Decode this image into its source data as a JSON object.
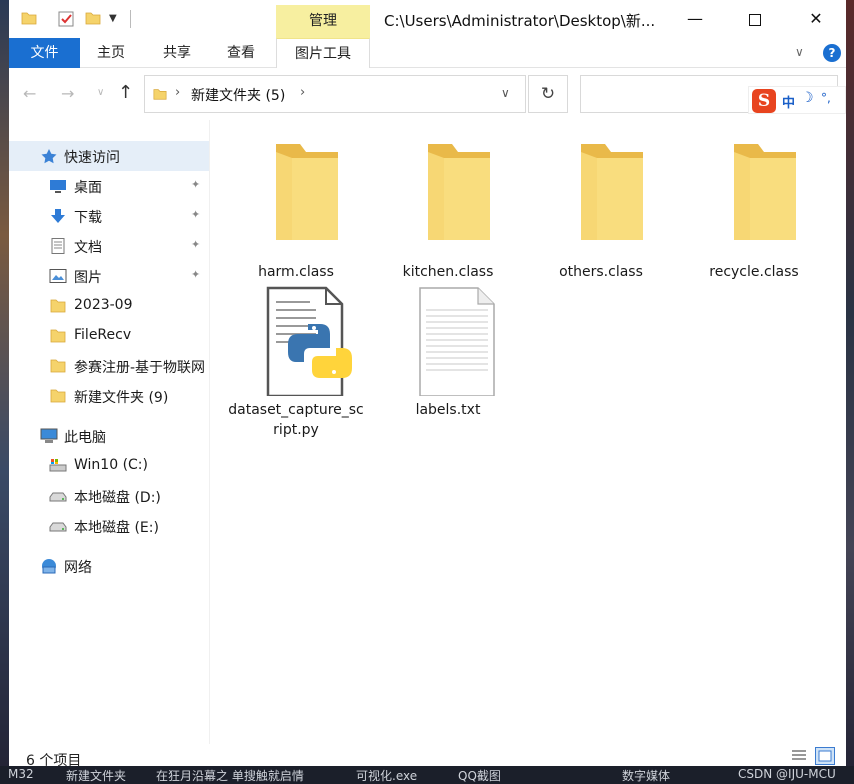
{
  "window": {
    "title_path": "C:\\Users\\Administrator\\Desktop\\新...",
    "manage_tab": "管理",
    "controls": {
      "minimize": "—",
      "maximize": "",
      "close": "✕"
    }
  },
  "ribbon": {
    "tabs": [
      "文件",
      "主页",
      "共享",
      "查看",
      "图片工具"
    ],
    "expand": "∨",
    "help": "?"
  },
  "nav": {
    "back": "←",
    "forward": "→",
    "recent": "∨",
    "up": "↑",
    "breadcrumb": "新建文件夹 (5)",
    "sep": "›",
    "dropdown": "∨",
    "refresh": "↻",
    "search_placeholder": ""
  },
  "ime": {
    "logo": "S",
    "lang": "中",
    "moon": "☽",
    "punct": "°,"
  },
  "sidebar": {
    "items": [
      {
        "label": "快速访问",
        "icon": "star-icon",
        "pinned": false
      },
      {
        "label": "桌面",
        "icon": "desktop-icon",
        "pinned": true
      },
      {
        "label": "下载",
        "icon": "download-icon",
        "pinned": true
      },
      {
        "label": "文档",
        "icon": "document-icon",
        "pinned": true
      },
      {
        "label": "图片",
        "icon": "pictures-icon",
        "pinned": true
      },
      {
        "label": "2023-09",
        "icon": "folder-icon",
        "pinned": false
      },
      {
        "label": "FileRecv",
        "icon": "folder-icon",
        "pinned": false
      },
      {
        "label": "参赛注册-基于物联网",
        "icon": "folder-icon",
        "pinned": false
      },
      {
        "label": "新建文件夹 (9)",
        "icon": "folder-icon",
        "pinned": false
      },
      {
        "label": "此电脑",
        "icon": "computer-icon",
        "pinned": false
      },
      {
        "label": "Win10 (C:)",
        "icon": "system-drive-icon",
        "pinned": false
      },
      {
        "label": "本地磁盘 (D:)",
        "icon": "drive-icon",
        "pinned": false
      },
      {
        "label": "本地磁盘 (E:)",
        "icon": "drive-icon",
        "pinned": false
      },
      {
        "label": "网络",
        "icon": "network-icon",
        "pinned": false
      }
    ],
    "pin_glyph": "📌"
  },
  "files": [
    {
      "name": "harm.class",
      "type": "folder"
    },
    {
      "name": "kitchen.class",
      "type": "folder"
    },
    {
      "name": "others.class",
      "type": "folder"
    },
    {
      "name": "recycle.class",
      "type": "folder"
    },
    {
      "name": "dataset_capture_script.py",
      "type": "python"
    },
    {
      "name": "labels.txt",
      "type": "text"
    }
  ],
  "status": {
    "count": "6 个项目"
  },
  "taskbar": {
    "items": [
      "M32",
      "新建文件夹",
      "在狂月沿幕之 单搜触就启情",
      "可视化.exe",
      "QQ截图",
      "数字媒体"
    ],
    "watermark": "CSDN @IJU-MCU"
  },
  "colors": {
    "accent": "#1a6fd1",
    "manage_tab": "#f7efa0",
    "folder": "#f5d36b",
    "selection": "#e5eef8"
  }
}
